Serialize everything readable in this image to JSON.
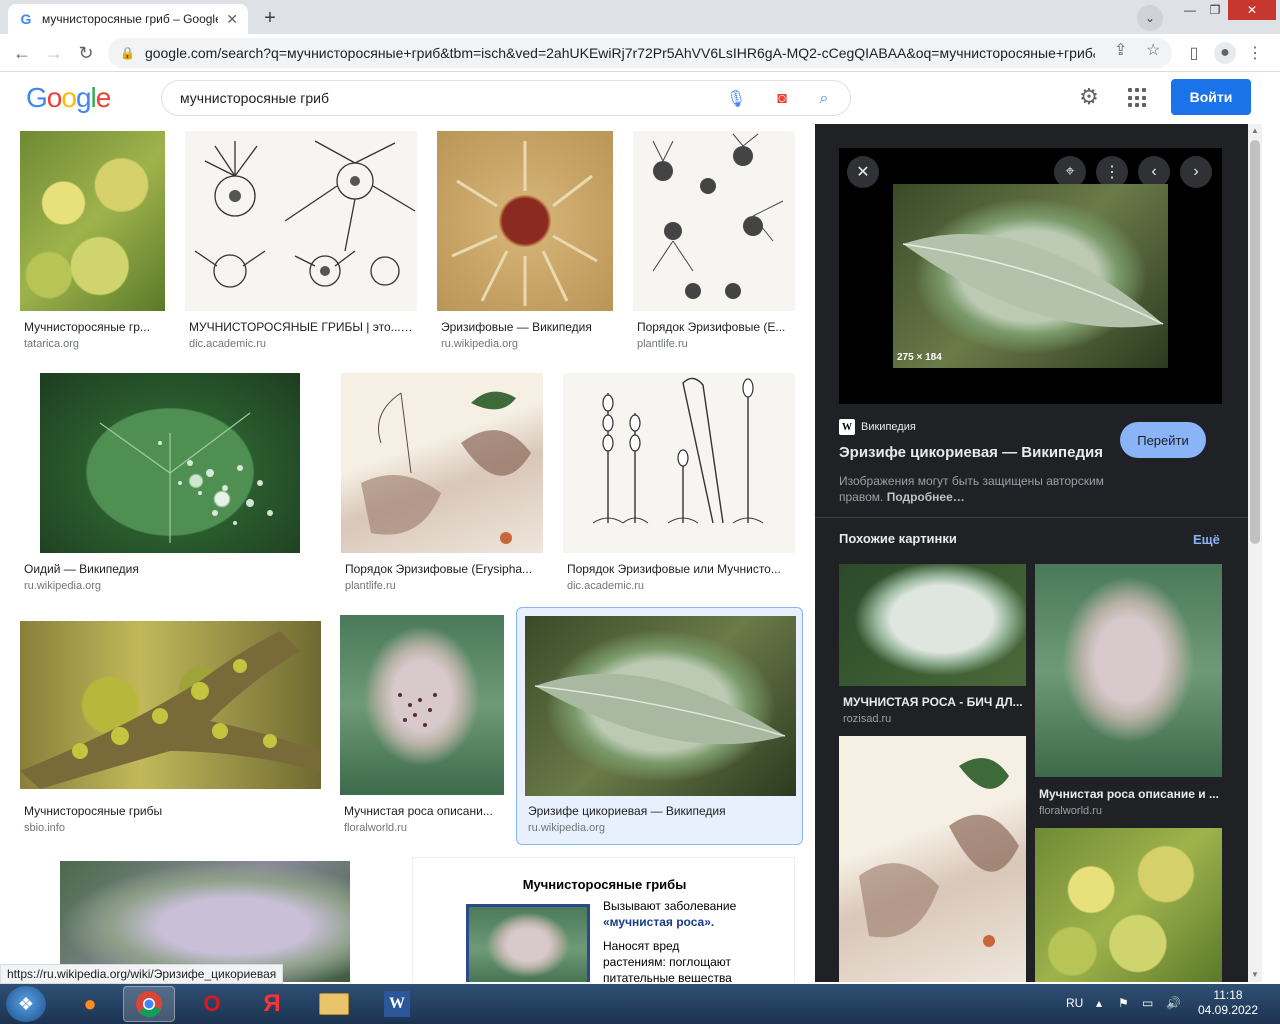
{
  "browser": {
    "tab_title": "мучнисторосяные гриб – Google",
    "tab_favicon": "G",
    "url": "google.com/search?q=мучнисторосяные+гриб&tbm=isch&ved=2ahUKEwiRj7r72Pr5AhVV6LsIHR6gA-MQ2-cCegQIABAA&oq=мучнисторосяные+гриб&..."
  },
  "header": {
    "logo_letters": [
      "G",
      "o",
      "o",
      "g",
      "l",
      "e"
    ],
    "logo_colors": [
      "#4285f4",
      "#ea4335",
      "#fbbc05",
      "#4285f4",
      "#34a853",
      "#ea4335"
    ],
    "query": "мучнисторосяные гриб",
    "signin_label": "Войти"
  },
  "results": [
    {
      "caption": "Мучнисторосяные гр...",
      "source": "tatarica.org"
    },
    {
      "caption": "МУЧНИСТОРОСЯНЫЕ ГРИБЫ | это... ...",
      "source": "dic.academic.ru"
    },
    {
      "caption": "Эризифовые — Википедия",
      "source": "ru.wikipedia.org"
    },
    {
      "caption": "Порядок Эризифовые (E...",
      "source": "plantlife.ru"
    },
    {
      "caption": "Оидий — Википедия",
      "source": "ru.wikipedia.org"
    },
    {
      "caption": "Порядок Эризифовые (Erysipha...",
      "source": "plantlife.ru"
    },
    {
      "caption": "Порядок Эризифовые или Мучнисто...",
      "source": "dic.academic.ru"
    },
    {
      "caption": "Мучнисторосяные грибы",
      "source": "sbio.info"
    },
    {
      "caption": "Мучнистая роса описани...",
      "source": "floralworld.ru"
    },
    {
      "caption": "Эризифе цикориевая — Википедия",
      "source": "ru.wikipedia.org"
    }
  ],
  "slide": {
    "title": "Мучнисторосяные грибы",
    "line1": "Вызывают заболевание",
    "line2": "«мучнистая роса».",
    "line3": "Наносят вред",
    "line4": "растениям: поглощают",
    "line5": "питательные вещества"
  },
  "panel": {
    "dimensions": "275 × 184",
    "source_name": "Википедия",
    "title": "Эризифе цикориевая — Википедия",
    "goto_label": "Перейти",
    "copyright": "Изображения могут быть защищены авторским правом.",
    "more_link": "Подробнее…",
    "similar_heading": "Похожие картинки",
    "similar_more": "Ещё",
    "similar": [
      {
        "caption": "МУЧНИСТАЯ РОСА - БИЧ ДЛ...",
        "source": "rozisad.ru"
      },
      {
        "caption": "Мучнистая роса описание и ...",
        "source": "floralworld.ru"
      }
    ]
  },
  "status_url": "https://ru.wikipedia.org/wiki/Эризифе_цикориевая",
  "taskbar": {
    "lang": "RU",
    "time": "11:18",
    "date": "04.09.2022",
    "yandex": "Я"
  }
}
